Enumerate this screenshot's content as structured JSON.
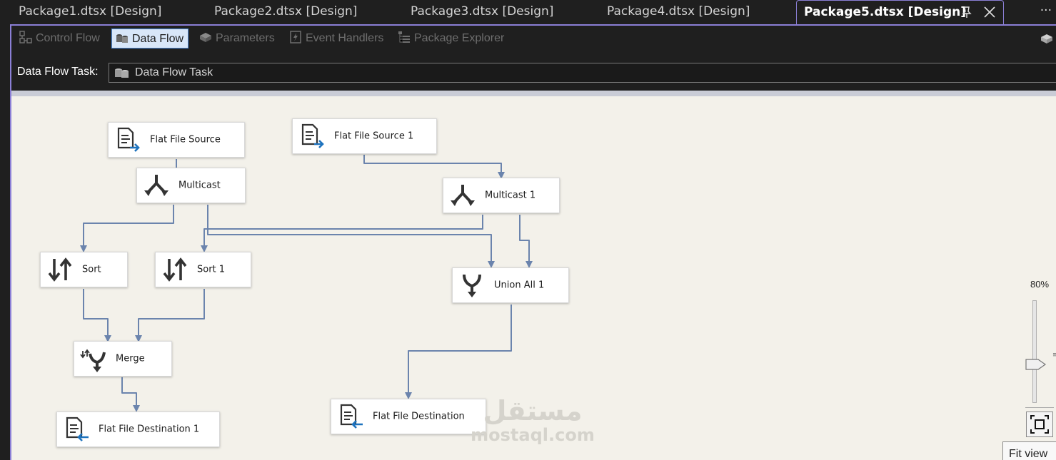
{
  "document_tabs": [
    {
      "label": "Package1.dtsx [Design]",
      "active": false
    },
    {
      "label": "Package2.dtsx [Design]",
      "active": false
    },
    {
      "label": "Package3.dtsx [Design]",
      "active": false
    },
    {
      "label": "Package4.dtsx [Design]",
      "active": false
    },
    {
      "label": "Package5.dtsx [Design]",
      "active": true
    }
  ],
  "tab_overflow": "···",
  "tab_pin_glyph": "📌",
  "tab_close_glyph": "✕",
  "designer_tabs": [
    {
      "label": "Control Flow",
      "icon": "control-flow-icon",
      "active": false
    },
    {
      "label": "Data Flow",
      "icon": "data-flow-icon",
      "active": true
    },
    {
      "label": "Parameters",
      "icon": "parameters-icon",
      "active": false
    },
    {
      "label": "Event Handlers",
      "icon": "event-handlers-icon",
      "active": false
    },
    {
      "label": "Package Explorer",
      "icon": "package-explorer-icon",
      "active": false
    }
  ],
  "task": {
    "label": "Data Flow Task:",
    "selected": "Data Flow Task"
  },
  "components": {
    "flat_file_source": "Flat File Source",
    "flat_file_source_1": "Flat File Source 1",
    "multicast": "Multicast",
    "multicast_1": "Multicast 1",
    "sort": "Sort",
    "sort_1": "Sort 1",
    "union_all_1": "Union All 1",
    "merge": "Merge",
    "flat_file_destination": "Flat File Destination",
    "flat_file_destination_1": "Flat File Destination 1"
  },
  "zoom": {
    "value_label": "80%",
    "level_percent": 80,
    "tooltip": "Fit view"
  },
  "watermark": {
    "arabic": "مستقل",
    "latin": "mostaql.com"
  },
  "colors": {
    "accent": "#8b7fd6",
    "wire": "#6b84ad",
    "canvas": "#f3f1ea",
    "active_tab_bg": "#d8e6f8"
  }
}
